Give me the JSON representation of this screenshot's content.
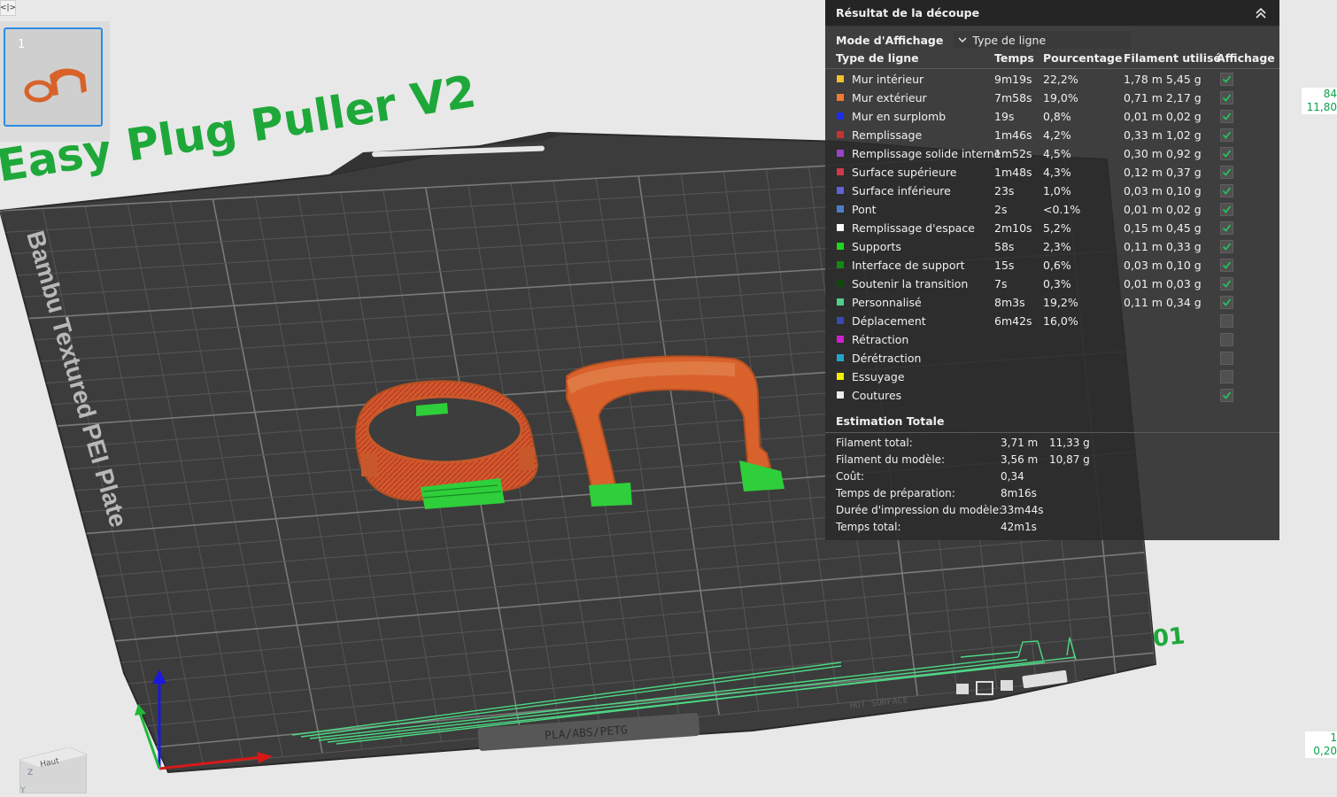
{
  "plate": {
    "name": "Easy Plug Puller V2",
    "sheet_label": "Bambu Textured PEI Plate",
    "plate_number": "01",
    "material_label": "PLA/ABS/PETG",
    "surface_label": "HOT SURFACE"
  },
  "sidebar": {
    "toggle_glyph": "<|>",
    "plate_thumb_number": "1"
  },
  "layer_slider": {
    "top_layer": "84",
    "top_height": "11,80",
    "bottom_layer": "1",
    "bottom_height": "0,20"
  },
  "view_cube": {
    "face_label": "Haut",
    "axis_z": "Z",
    "axis_y": "Y"
  },
  "result_panel": {
    "title": "Résultat de la découpe",
    "mode_label": "Mode d'Affichage",
    "mode_value": "Type de ligne",
    "headers": {
      "line_type": "Type de ligne",
      "time": "Temps",
      "percent": "Pourcentage",
      "filament": "Filament utilisé",
      "display": "Affichage"
    },
    "rows": [
      {
        "name": "Mur intérieur",
        "color": "#f2c12e",
        "time": "9m19s",
        "pct": "22,2%",
        "len": "1,78 m",
        "wt": "5,45 g",
        "shown": true
      },
      {
        "name": "Mur extérieur",
        "color": "#f07a30",
        "time": "7m58s",
        "pct": "19,0%",
        "len": "0,71 m",
        "wt": "2,17 g",
        "shown": true
      },
      {
        "name": "Mur en surplomb",
        "color": "#1c2cf0",
        "time": "19s",
        "pct": "0,8%",
        "len": "0,01 m",
        "wt": "0,02 g",
        "shown": true
      },
      {
        "name": "Remplissage",
        "color": "#c2352e",
        "time": "1m46s",
        "pct": "4,2%",
        "len": "0,33 m",
        "wt": "1,02 g",
        "shown": true
      },
      {
        "name": "Remplissage solide interne",
        "color": "#9a44c8",
        "time": "1m52s",
        "pct": "4,5%",
        "len": "0,30 m",
        "wt": "0,92 g",
        "shown": true
      },
      {
        "name": "Surface supérieure",
        "color": "#d2384a",
        "time": "1m48s",
        "pct": "4,3%",
        "len": "0,12 m",
        "wt": "0,37 g",
        "shown": true
      },
      {
        "name": "Surface inférieure",
        "color": "#6262d8",
        "time": "23s",
        "pct": "1,0%",
        "len": "0,03 m",
        "wt": "0,10 g",
        "shown": true
      },
      {
        "name": "Pont",
        "color": "#4d7fc6",
        "time": "2s",
        "pct": "<0.1%",
        "len": "0,01 m",
        "wt": "0,02 g",
        "shown": true
      },
      {
        "name": "Remplissage d'espace",
        "color": "#ffffff",
        "time": "2m10s",
        "pct": "5,2%",
        "len": "0,15 m",
        "wt": "0,45 g",
        "shown": true
      },
      {
        "name": "Supports",
        "color": "#1ed61e",
        "time": "58s",
        "pct": "2,3%",
        "len": "0,11 m",
        "wt": "0,33 g",
        "shown": true
      },
      {
        "name": "Interface de support",
        "color": "#128a12",
        "time": "15s",
        "pct": "0,6%",
        "len": "0,03 m",
        "wt": "0,10 g",
        "shown": true
      },
      {
        "name": "Soutenir la transition",
        "color": "#0c4a0c",
        "time": "7s",
        "pct": "0,3%",
        "len": "0,01 m",
        "wt": "0,03 g",
        "shown": true
      },
      {
        "name": "Personnalisé",
        "color": "#4ecf8a",
        "time": "8m3s",
        "pct": "19,2%",
        "len": "0,11 m",
        "wt": "0,34 g",
        "shown": true
      },
      {
        "name": "Déplacement",
        "color": "#3a48b0",
        "time": "6m42s",
        "pct": "16,0%",
        "len": "",
        "wt": "",
        "shown": false
      },
      {
        "name": "Rétraction",
        "color": "#d01fcf",
        "time": "",
        "pct": "",
        "len": "",
        "wt": "",
        "shown": false
      },
      {
        "name": "Dérétraction",
        "color": "#23a6c8",
        "time": "",
        "pct": "",
        "len": "",
        "wt": "",
        "shown": false
      },
      {
        "name": "Essuyage",
        "color": "#f4f000",
        "time": "",
        "pct": "",
        "len": "",
        "wt": "",
        "shown": false
      },
      {
        "name": "Coutures",
        "color": "#ececec",
        "time": "",
        "pct": "",
        "len": "",
        "wt": "",
        "shown": true
      }
    ],
    "totals_title": "Estimation Totale",
    "totals": [
      {
        "label": "Filament total:",
        "v1": "3,71 m",
        "v2": "11,33 g"
      },
      {
        "label": "Filament du modèle:",
        "v1": "3,56 m",
        "v2": "10,87 g"
      },
      {
        "label": "Coût:",
        "v1": "0,34",
        "v2": ""
      },
      {
        "label": "Temps de préparation:",
        "v1": "8m16s",
        "v2": ""
      },
      {
        "label": "Durée d'impression du modèle:",
        "v1": "33m44s",
        "v2": ""
      },
      {
        "label": "Temps total:",
        "v1": "42m1s",
        "v2": ""
      }
    ]
  }
}
